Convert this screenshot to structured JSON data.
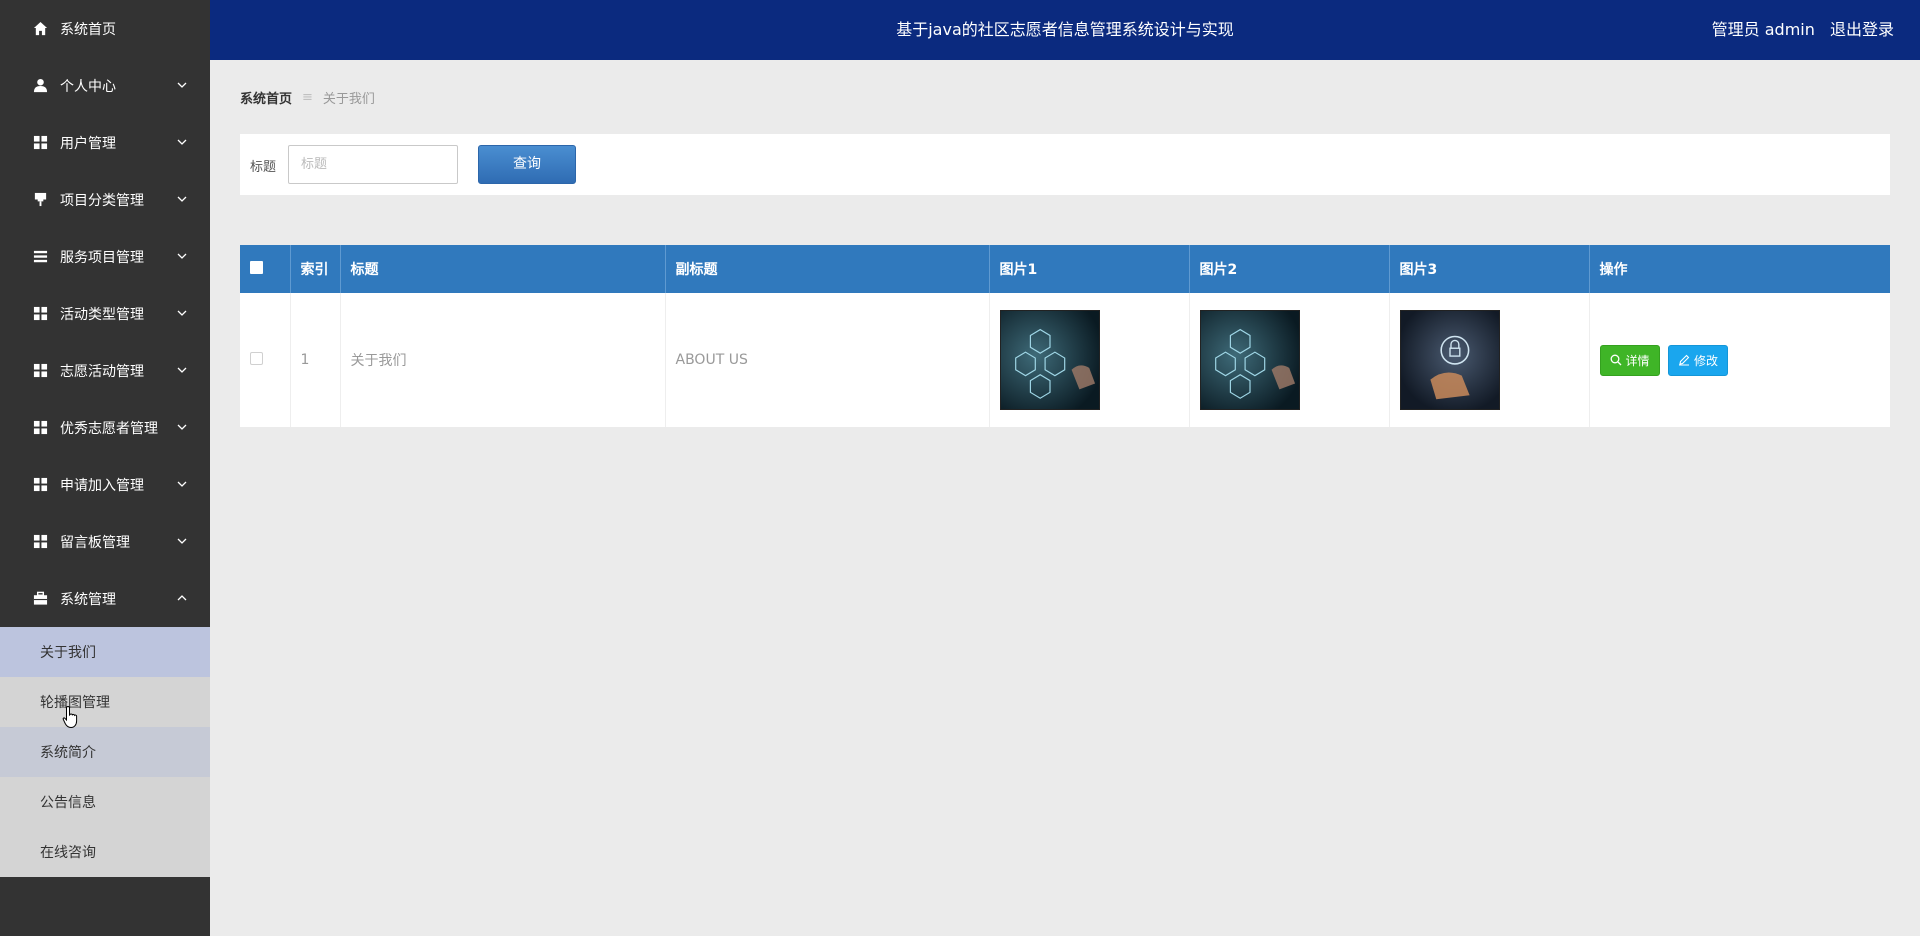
{
  "header": {
    "title": "基于java的社区志愿者信息管理系统设计与实现",
    "user_label": "管理员 admin",
    "logout_label": "退出登录"
  },
  "sidebar": {
    "items": [
      {
        "label": "系统首页",
        "icon": "home-icon"
      },
      {
        "label": "个人中心",
        "icon": "user-icon"
      },
      {
        "label": "用户管理",
        "icon": "grid-icon"
      },
      {
        "label": "项目分类管理",
        "icon": "pin-icon"
      },
      {
        "label": "服务项目管理",
        "icon": "list-icon"
      },
      {
        "label": "活动类型管理",
        "icon": "grid-icon"
      },
      {
        "label": "志愿活动管理",
        "icon": "grid-icon"
      },
      {
        "label": "优秀志愿者管理",
        "icon": "grid-icon"
      },
      {
        "label": "申请加入管理",
        "icon": "grid-icon"
      },
      {
        "label": "留言板管理",
        "icon": "grid-icon"
      },
      {
        "label": "系统管理",
        "icon": "briefcase-icon"
      }
    ],
    "submenu": [
      {
        "label": "关于我们"
      },
      {
        "label": "轮播图管理"
      },
      {
        "label": "系统简介"
      },
      {
        "label": "公告信息"
      },
      {
        "label": "在线咨询"
      }
    ]
  },
  "breadcrumb": {
    "home": "系统首页",
    "separator": "≡",
    "current": "关于我们"
  },
  "search": {
    "label": "标题",
    "placeholder": "标题",
    "button": "查询"
  },
  "table": {
    "columns": [
      "索引",
      "标题",
      "副标题",
      "图片1",
      "图片2",
      "图片3",
      "操作"
    ],
    "rows": [
      {
        "index": "1",
        "title": "关于我们",
        "subtitle": "ABOUT US"
      }
    ],
    "actions": {
      "detail": "详情",
      "edit": "修改"
    }
  },
  "colors": {
    "header_bg": "#0b2a7f",
    "sidebar_bg": "#333333",
    "table_header_bg": "#3079bd",
    "detail_btn": "#3fb527",
    "edit_btn": "#1aa6ee"
  }
}
